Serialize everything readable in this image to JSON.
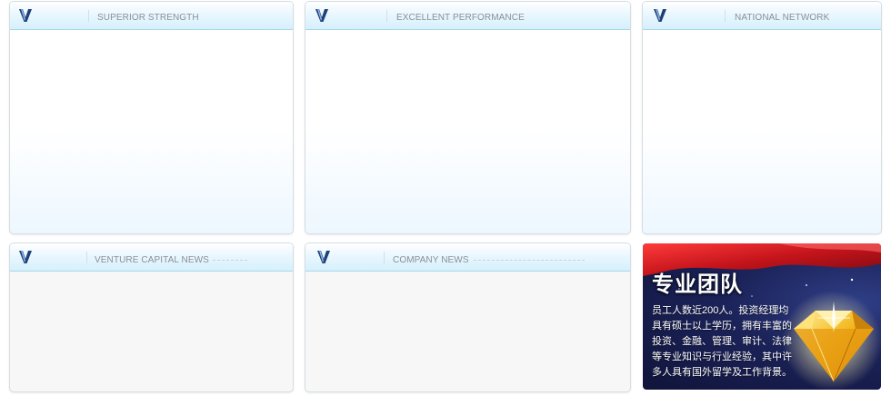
{
  "panels": {
    "superior_strength": {
      "title": "SUPERIOR STRENGTH"
    },
    "excellent_performance": {
      "title": "EXCELLENT PERFORMANCE"
    },
    "national_network": {
      "title": "NATIONAL NETWORK"
    },
    "venture_capital_news": {
      "title": "VENTURE CAPITAL NEWS"
    },
    "company_news": {
      "title": "COMPANY NEWS"
    }
  },
  "team": {
    "title": "专业团队",
    "description": "员工人数近200人。投资经理均具有硕士以上学历，拥有丰富的投资、金融、管理、审计、法律等专业知识与行业经验，其中许多人具有国外留学及工作背景。"
  },
  "colors": {
    "header_border": "#a9d9ec",
    "header_text": "#8a8f94",
    "logo_blue": "#1e3f78",
    "banner_dark": "#10143a",
    "ribbon_red": "#d8232a",
    "gem_gold": "#f2b418"
  },
  "icons": {
    "logo": "v-logo-icon"
  }
}
